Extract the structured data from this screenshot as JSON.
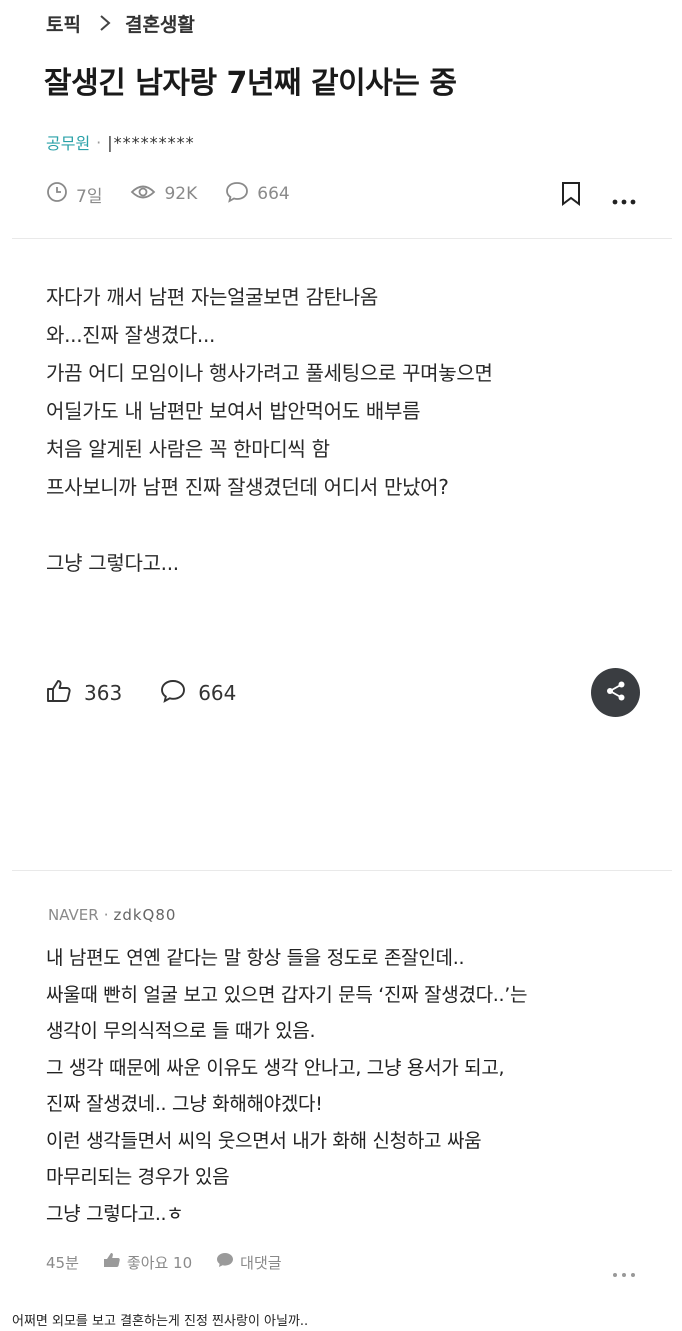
{
  "breadcrumb": {
    "topic": "토픽",
    "category": "결혼생활"
  },
  "post": {
    "title": "잘생긴 남자랑 7년째 같이사는 중",
    "author": {
      "company": "공무원",
      "nickname": "|*********"
    },
    "meta": {
      "time": "7일",
      "views": "92K",
      "comments": "664"
    },
    "body": [
      "자다가 깨서 남편 자는얼굴보면 감탄나옴",
      "와...진짜 잘생겼다...",
      "가끔 어디 모임이나 행사가려고 풀세팅으로 꾸며놓으면",
      "어딜가도 내 남편만 보여서 밥안먹어도 배부름",
      "처음 알게된 사람은 꼭 한마디씩 함",
      "프사보니까 남편 진짜 잘생겼던데 어디서 만났어?",
      "",
      "그냥 그렇다고..."
    ],
    "likes": "363",
    "comment_count": "664"
  },
  "comment": {
    "company": "NAVER",
    "nickname": "zdkQ80",
    "lines": [
      "내 남편도 연옌 같다는 말 항상 들을 정도로 존잘인데..",
      "싸울때 빤히 얼굴 보고 있으면 갑자기 문득 ‘진짜 잘생겼다..’는",
      "생각이 무의식적으로 들 때가 있음.",
      "그 생각 때문에 싸운 이유도 생각 안나고, 그냥 용서가 되고,",
      "진짜 잘생겼네.. 그냥 화해해야겠다!",
      "이런 생각들면서 씨익 웃으면서 내가 화해 신청하고 싸움",
      "마무리되는 경우가 있음",
      "그냥 그렇다고..ㅎ"
    ],
    "time": "45분",
    "like_label": "좋아요 10",
    "reply_label": "대댓글"
  },
  "caption": "어쩌면 외모를 보고 결혼하는게 진정 찐사랑이 아닐까..",
  "icons": [
    "chevron-right-icon",
    "clock-icon",
    "eye-icon",
    "comment-icon",
    "bookmark-icon",
    "more-icon",
    "thumbs-up-icon",
    "share-icon"
  ]
}
